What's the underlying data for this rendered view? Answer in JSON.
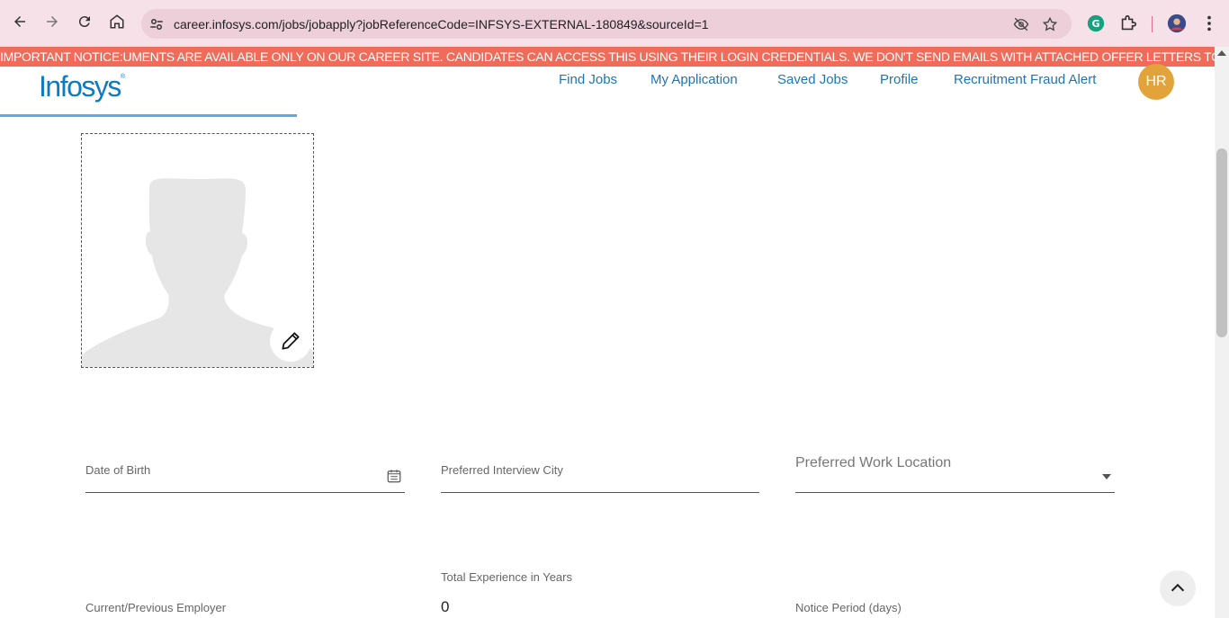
{
  "browser": {
    "url": "career.infosys.com/jobs/jobapply?jobReferenceCode=INFSYS-EXTERNAL-180849&sourceId=1"
  },
  "notice": {
    "text": "IMPORTANT NOTICE:UMENTS ARE AVAILABLE ONLY ON OUR CAREER SITE. CANDIDATES CAN ACCESS THIS USING THEIR LOGIN CREDENTIALS. WE DON'T SEND EMAILS WITH ATTACHED OFFER LETTERS TO C"
  },
  "header": {
    "logo": "Infosys",
    "logo_mark": "®",
    "nav": [
      {
        "label": "Find Jobs"
      },
      {
        "label": "My Application"
      },
      {
        "label": "Saved Jobs"
      },
      {
        "label": "Profile"
      },
      {
        "label": "Recruitment Fraud Alert"
      }
    ],
    "avatar_initials": "HR"
  },
  "form": {
    "date_of_birth_label": "Date of Birth",
    "interview_city_label": "Preferred Interview City",
    "work_location_label": "Preferred Work Location",
    "total_experience_label": "Total Experience in Years",
    "total_experience_value": "0",
    "employer_label": "Current/Previous Employer",
    "notice_period_label": "Notice Period (days)"
  },
  "colors": {
    "notice_bg": "#ef6c5a",
    "brand_blue": "#0a7bc4",
    "nav_blue": "#1f74b8",
    "avatar_bg": "#e2a33b"
  }
}
